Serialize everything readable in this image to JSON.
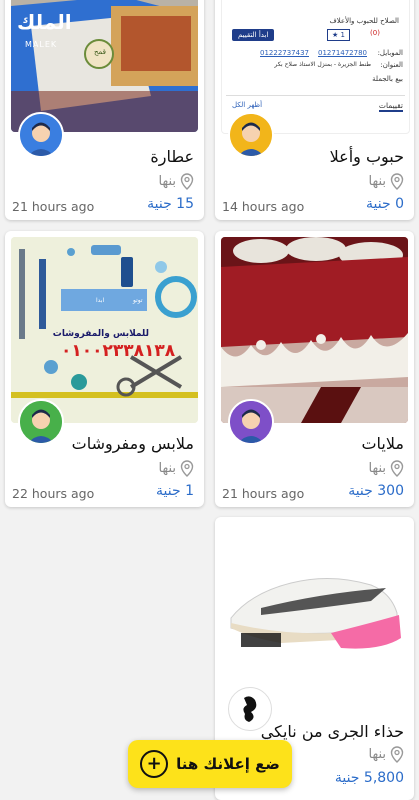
{
  "listings": [
    {
      "title": "عطارة",
      "location": "بنها",
      "time": "21 hours ago",
      "price": "15 جنية"
    },
    {
      "title": "حبوب وأعلا",
      "location": "بنها",
      "time": "14 hours ago",
      "price": "0 جنية"
    },
    {
      "title": "ملابس ومفروشات",
      "location": "بنها",
      "time": "22 hours ago",
      "price": "1 جنية"
    },
    {
      "title": "ملايات",
      "location": "بنها",
      "time": "21 hours ago",
      "price": "300 جنية"
    },
    {
      "title": "حذاء الجرى من نايكي",
      "location": "بنها",
      "time": "",
      "price": "5,800 جنية"
    }
  ],
  "images": {
    "attar": {
      "brand_text": "الملك",
      "brand_sub": "MALEK",
      "brand_tag": "قمح"
    },
    "grains": {
      "header": "الصلاح للحبوب والأعلاف",
      "rate_label": "ابدأ التقييم",
      "count": "1",
      "count2": "0",
      "mobile_label": "الموبايل:",
      "mobile1": "01271472780",
      "mobile2": "01222737437",
      "address_label": "العنوان:",
      "address": "طنط الجزيرة - بمنزل الاستاذ صلاح بكر",
      "wholesale": "بيع بالجملة",
      "tab_reviews": "تقييمات",
      "show_all": "أظهر الكل"
    },
    "fabric_ad": {
      "headline": "للملابس والمفروشات",
      "phone": "٠١٠٠٢٣٣٨١٣٨",
      "small1": "ابدا",
      "small2": "توتو"
    }
  },
  "fab": {
    "label": "ضع إعلانك هنا"
  }
}
